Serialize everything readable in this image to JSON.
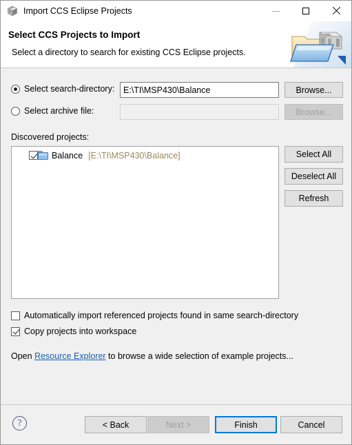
{
  "window": {
    "title": "Import CCS Eclipse Projects",
    "app_icon": "ccs-cube-icon",
    "controls": {
      "minimize": "minimize-icon",
      "maximize": "maximize-icon",
      "close": "close-icon"
    }
  },
  "header": {
    "title": "Select CCS Projects to Import",
    "subtitle": "Select a directory to search for existing CCS Eclipse projects.",
    "banner_icon": "folder-with-cube-icon"
  },
  "source": {
    "search_directory": {
      "radio_label": "Select search-directory:",
      "selected": true,
      "value": "E:\\TI\\MSP430\\Balance",
      "browse_label": "Browse...",
      "browse_enabled": true
    },
    "archive_file": {
      "radio_label": "Select archive file:",
      "selected": false,
      "value": "",
      "browse_label": "Browse...",
      "browse_enabled": false
    }
  },
  "discovered": {
    "label": "Discovered projects:",
    "projects": [
      {
        "name": "Balance",
        "path": "[E:\\TI\\MSP430\\Balance]",
        "checked": true,
        "icon": "folder-icon"
      }
    ],
    "buttons": {
      "select_all": "Select All",
      "deselect_all": "Deselect All",
      "refresh": "Refresh"
    }
  },
  "options": [
    {
      "label": "Automatically import referenced projects found in same search-directory",
      "checked": false
    },
    {
      "label": "Copy projects into workspace",
      "checked": true
    }
  ],
  "resource_link": {
    "prefix": "Open ",
    "link_text": "Resource Explorer",
    "suffix": " to browse a wide selection of example projects..."
  },
  "footer": {
    "help_icon": "help-icon",
    "help_glyph": "?",
    "back": "< Back",
    "next": "Next >",
    "finish": "Finish",
    "cancel": "Cancel",
    "next_enabled": false,
    "default_button": "Finish"
  },
  "colors": {
    "accent": "#0078d7",
    "link": "#1a5fb4",
    "path_text": "#9c8a5a",
    "dialog_bg": "#f0f0f0"
  }
}
